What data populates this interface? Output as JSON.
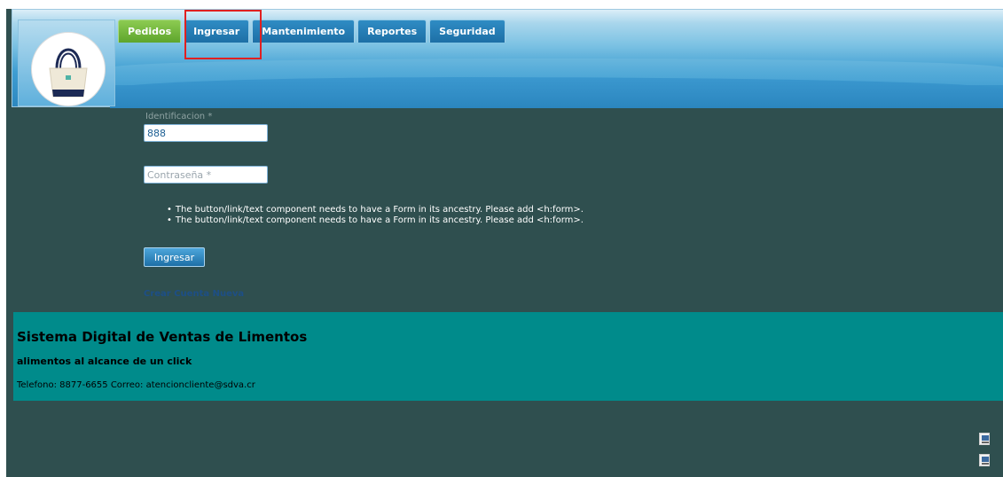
{
  "nav": {
    "tabs": [
      {
        "label": "Pedidos",
        "active": true
      },
      {
        "label": "Ingresar",
        "active": false
      },
      {
        "label": "Mantenimiento",
        "active": false
      },
      {
        "label": "Reportes",
        "active": false
      },
      {
        "label": "Seguridad",
        "active": false
      }
    ]
  },
  "logo": {
    "icon": "tote-bag-icon"
  },
  "form": {
    "id_label": "Identificacion *",
    "id_value": "888",
    "password_placeholder": "Contraseña *",
    "errors": [
      "The button/link/text component needs to have a Form in its ancestry. Please add <h:form>.",
      "The button/link/text component needs to have a Form in its ancestry. Please add <h:form>."
    ],
    "submit_label": "Ingresar",
    "new_account_label": "Crear Cuenta Nueva"
  },
  "footer": {
    "title": "Sistema Digital de Ventas de Limentos",
    "slogan": "alimentos al alcance de un click",
    "contact": "Telefono: 8877-6655 Correo: atencioncliente@sdva.cr"
  },
  "colors": {
    "background": "#2f4f4f",
    "footer": "#008b8b",
    "tab_active": "#6aaf36",
    "tab": "#1f77b4",
    "highlight": "#e02020"
  }
}
